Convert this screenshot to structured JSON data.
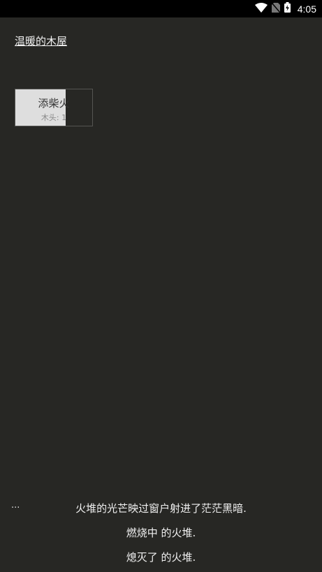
{
  "status_bar": {
    "time": "4:05",
    "icons": [
      "wifi-icon",
      "no-sim-icon",
      "battery-charging-icon"
    ]
  },
  "location": {
    "label": "温暖的木屋"
  },
  "stoke_button": {
    "label": "添柴火",
    "cost": "木头: 1",
    "cooldown_progress": 0.65
  },
  "ellipsis": "...",
  "notifications": [
    "火堆的光芒映过窗户射进了茫茫黑暗.",
    "燃烧中 的火堆.",
    "熄灭了 的火堆."
  ],
  "colors": {
    "background": "#272724",
    "text": "#f0f0f0",
    "button_fill": "#dedede",
    "button_border": "#555552"
  }
}
